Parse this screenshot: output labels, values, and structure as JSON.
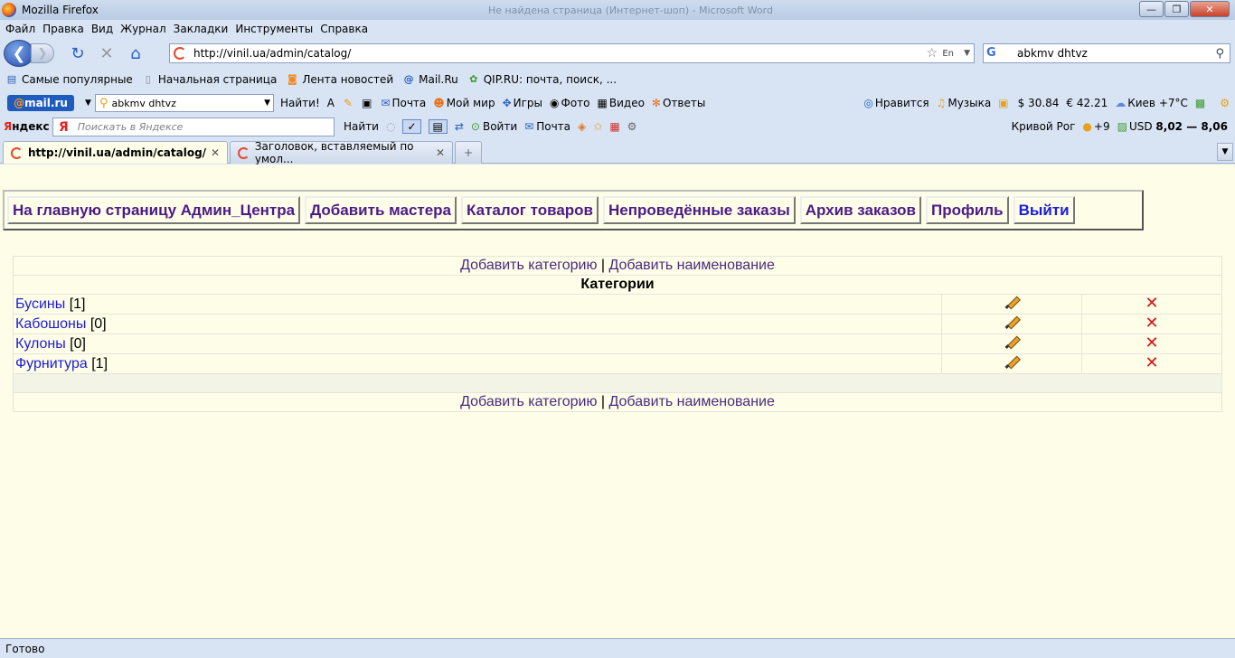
{
  "window": {
    "title": "Mozilla Firefox",
    "faded_title": "Не найдена страница (Интернет-шоп) - Microsoft Word"
  },
  "menu": [
    "Файл",
    "Правка",
    "Вид",
    "Журнал",
    "Закладки",
    "Инструменты",
    "Справка"
  ],
  "nav": {
    "url": "http://vinil.ua/admin/catalog/",
    "lang_indicator": "En",
    "search_value": "abkmv dhtvz"
  },
  "bookmarks": [
    "Самые популярные",
    "Начальная страница",
    "Лента новостей",
    "Mail.Ru",
    "QIP.RU: почта, поиск, ..."
  ],
  "mailru": {
    "logo_at": "@",
    "logo_text": "mail.ru",
    "search_value": "abkmv dhtvz",
    "find_label": "Найти!",
    "items": [
      "Почта",
      "Мой мир",
      "Игры",
      "Фото",
      "Видео",
      "Ответы"
    ],
    "right": [
      "Нравится",
      "Музыка",
      "$ 30.84",
      "€ 42.21",
      "Киев +7°C"
    ]
  },
  "yandex": {
    "logo_r": "Я",
    "logo_rest": "ндекс",
    "search_placeholder": "Поискать в Яндексе",
    "find_label": "Найти",
    "login_label": "Войти",
    "mail_label": "Почта",
    "city": "Кривой Рог",
    "temp": "+9",
    "usd_label": "USD",
    "usd_value": "8,02 — 8,06"
  },
  "tabs": [
    {
      "title": "http://vinil.ua/admin/catalog/"
    },
    {
      "title": "Заголовок, вставляемый по умол..."
    }
  ],
  "admin_nav": [
    "На главную страницу Админ_Центра",
    "Добавить мастера",
    "Каталог товаров",
    "Непроведённые заказы",
    "Архив заказов",
    "Профиль",
    "Выйти"
  ],
  "catalog": {
    "add_category": "Добавить категорию",
    "separator": "|",
    "add_item": "Добавить наименование",
    "header": "Категории",
    "categories": [
      {
        "name": "Бусины",
        "count": "[1]"
      },
      {
        "name": "Кабошоны",
        "count": "[0]"
      },
      {
        "name": "Кулоны",
        "count": "[0]"
      },
      {
        "name": "Фурнитура",
        "count": "[1]"
      }
    ]
  },
  "status": "Готово"
}
